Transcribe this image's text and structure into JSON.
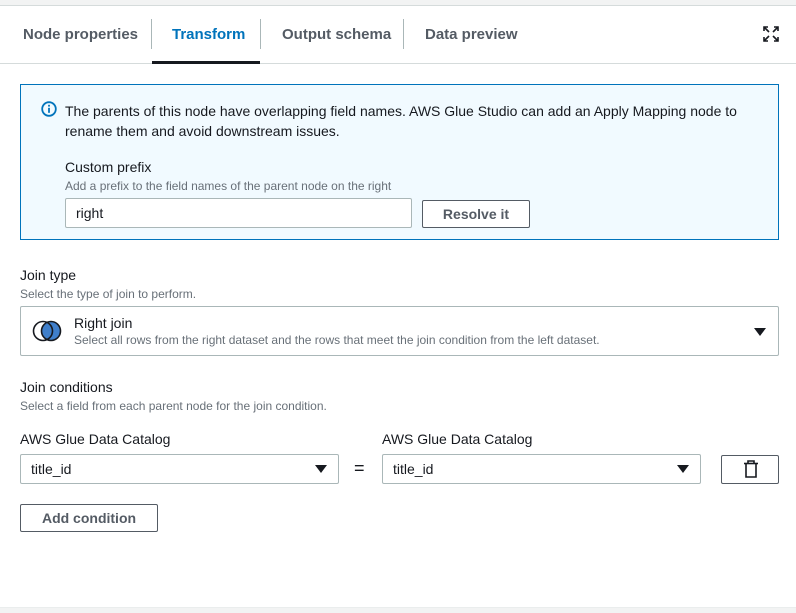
{
  "tabs": [
    {
      "label": "Node properties",
      "active": false
    },
    {
      "label": "Transform",
      "active": true
    },
    {
      "label": "Output schema",
      "active": false
    },
    {
      "label": "Data preview",
      "active": false
    }
  ],
  "expand_icon": "expand-icon",
  "alert": {
    "icon": "info-icon",
    "message": "The parents of this node have overlapping field names. AWS Glue Studio can add an Apply Mapping node to rename them and avoid downstream issues.",
    "prefix_label": "Custom prefix",
    "prefix_description": "Add a prefix to the field names of the parent node on the right",
    "prefix_value": "right",
    "resolve_label": "Resolve it"
  },
  "join_type": {
    "label": "Join type",
    "description": "Select the type of join to perform.",
    "selected_title": "Right join",
    "selected_description": "Select all rows from the right dataset and the rows that meet the join condition from the left dataset.",
    "icon": "venn-right-join-icon"
  },
  "join_conditions": {
    "label": "Join conditions",
    "description": "Select a field from each parent node for the join condition.",
    "left_source": "AWS Glue Data Catalog",
    "right_source": "AWS Glue Data Catalog",
    "left_field": "title_id",
    "right_field": "title_id",
    "operator": "=",
    "delete_icon": "trash-icon",
    "add_label": "Add condition"
  },
  "colors": {
    "accent": "#0073bb",
    "alert_bg": "#f1faff",
    "border": "#aab7b8",
    "text": "#16191f",
    "muted": "#687078"
  }
}
